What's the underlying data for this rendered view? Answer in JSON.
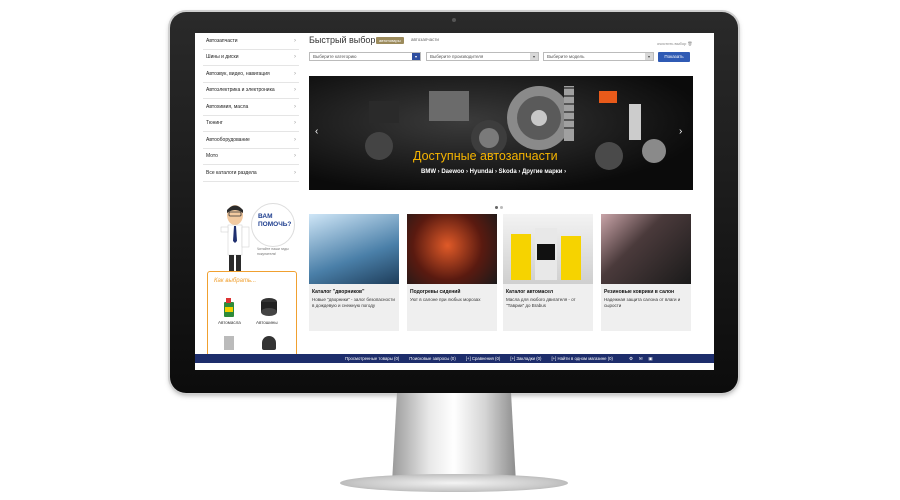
{
  "sidebar": {
    "items": [
      {
        "label": "Автозапчасти"
      },
      {
        "label": "Шины и диски"
      },
      {
        "label": "Автозвук, видео, навигация"
      },
      {
        "label": "Автоэлектрика и электроника"
      },
      {
        "label": "Автохимия, масла"
      },
      {
        "label": "Тюнинг"
      },
      {
        "label": "Автооборудование"
      },
      {
        "label": "Мото"
      },
      {
        "label": "Все каталоги раздела"
      }
    ]
  },
  "helper": {
    "bubble_line1": "ВАМ",
    "bubble_line2": "ПОМОЧЬ?",
    "note": "Читайте наши гиды покупателя!",
    "choose_title": "Как выбрать...",
    "choose_item1": "Автомасла",
    "choose_item2": "Автошины"
  },
  "quick": {
    "title": "Быстрый выбор",
    "tag_active": "автотовары",
    "tag_other": "автозапчасти",
    "clear_label": "очистить выбор",
    "select1": "Выберите категорию",
    "select2": "Выберите производителя",
    "select3": "Выберите модель",
    "show_button": "Показать"
  },
  "banner": {
    "title": "Доступные автозапчасти",
    "brands": "BMW › Daewoo › Hyundai › Skoda › Другие марки ›"
  },
  "cards": [
    {
      "title": "Каталог \"дворников\"",
      "desc": "Новые \"дворники\" - залог безопасности в дождевую и снежную погоду"
    },
    {
      "title": "Подогревы сидений",
      "desc": "Уют в салоне при любых морозах"
    },
    {
      "title": "Каталог автомасел",
      "desc": "Масла для любого двигателя - от \"Таврии\" до Brabus"
    },
    {
      "title": "Резиновые коврики в салон",
      "desc": "Надежная защита салона от влаги и сырости"
    }
  ],
  "bottombar": {
    "viewed": "Просмотренные товары (0)",
    "searches": "Поисковые запросы (0)",
    "compare": "[+] Сравнения (0)",
    "bookmarks": "[+] Закладки (0)",
    "one_store": "[+] Найти в одном магазине (0)"
  },
  "colors": {
    "accent": "#2f5ab4",
    "banner_text": "#f5b400",
    "bottom_bar": "#1d2d6b",
    "guide_border": "#f0a030"
  }
}
